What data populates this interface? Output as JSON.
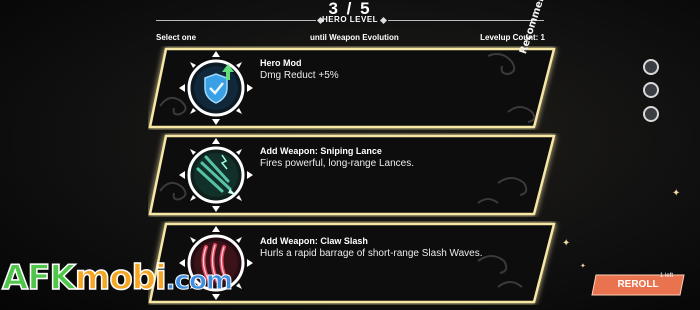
{
  "header": {
    "progress": "3 / 5",
    "hero_level": "HERO LEVEL",
    "select_one": "Select one",
    "until_evolution": "until Weapon Evolution",
    "levelup_count": "Levelup Count: 1"
  },
  "cards": [
    {
      "title": "Hero Mod",
      "description": "Dmg Reduct +5%",
      "icon": "shield-upgrade-icon",
      "badge": "Recommended"
    },
    {
      "title": "Add Weapon: Sniping Lance",
      "description": "Fires powerful, long-range Lances.",
      "icon": "sniping-lance-icon"
    },
    {
      "title": "Add Weapon: Claw Slash",
      "description": "Hurls a rapid barrage of short-range Slash Waves.",
      "icon": "claw-slash-icon"
    }
  ],
  "side_slots": 3,
  "reroll": {
    "label": "REROLL",
    "left_count": "1 left"
  },
  "watermark": {
    "part1": "AFK",
    "part2": "mobi",
    "part3": ".com"
  },
  "colors": {
    "card_glow": "#f6e7a6",
    "card_fill": "#0b0b0b",
    "emblem_ring": "#ffffff",
    "shield_icon": "#3aa0e6",
    "lance_icon": "#56c2a6",
    "claw_icon": "#e04a62",
    "reroll_button": "#e8734e"
  }
}
